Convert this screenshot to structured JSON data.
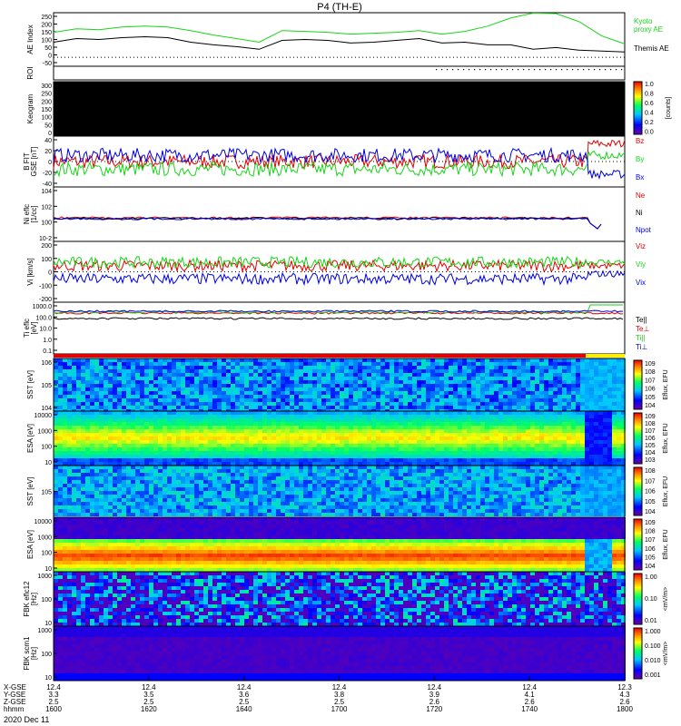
{
  "title": "P4 (TH-E)",
  "date_label": "2020 Dec 11",
  "ephemeris": {
    "row_labels": [
      "X-GSE",
      "Y-GSE",
      "Z-GSE",
      "hhmm"
    ],
    "columns": [
      {
        "x": "12.4",
        "y": "3.3",
        "z": "2.5",
        "t": "1600"
      },
      {
        "x": "12.4",
        "y": "3.5",
        "z": "2.5",
        "t": "1620"
      },
      {
        "x": "12.4",
        "y": "3.6",
        "z": "2.5",
        "t": "1640"
      },
      {
        "x": "12.4",
        "y": "3.8",
        "z": "2.5",
        "t": "1700"
      },
      {
        "x": "12.4",
        "y": "3.9",
        "z": "2.6",
        "t": "1720"
      },
      {
        "x": "12.4",
        "y": "4.1",
        "z": "2.6",
        "t": "1740"
      },
      {
        "x": "12.3",
        "y": "4.3",
        "z": "2.6",
        "t": "1800"
      }
    ]
  },
  "colors": {
    "red": "#e00000",
    "green": "#16d616",
    "blue": "#0000dd",
    "black": "#000000"
  },
  "chart_data": [
    {
      "type": "line",
      "panel": "ae",
      "ylabel": "AE Index",
      "ylim": [
        -50,
        250
      ],
      "yticks": [
        "250",
        "200",
        "150",
        "100",
        "50",
        "0",
        "-50"
      ],
      "x": [
        1550,
        1560,
        1570,
        1580,
        1590,
        1600,
        1610,
        1620,
        1630,
        1640,
        1650,
        1660,
        1670,
        1680,
        1690,
        1700,
        1710,
        1720,
        1730,
        1740,
        1750,
        1760,
        1770,
        1780,
        1790,
        1800
      ],
      "series": [
        {
          "name": "Kyoto proxy AE",
          "color": "green",
          "values": [
            140,
            160,
            155,
            170,
            175,
            170,
            150,
            125,
            105,
            85,
            150,
            145,
            140,
            130,
            135,
            140,
            150,
            130,
            145,
            175,
            220,
            248,
            245,
            200,
            120,
            75
          ]
        },
        {
          "name": "Themis AE",
          "color": "black",
          "values": [
            85,
            105,
            100,
            110,
            115,
            110,
            85,
            70,
            60,
            45,
            95,
            100,
            95,
            80,
            85,
            95,
            105,
            80,
            85,
            70,
            70,
            45,
            55,
            40,
            35,
            30
          ]
        }
      ]
    },
    {
      "type": "table",
      "panel": "roi",
      "ylabel": "ROI"
    },
    {
      "type": "heatmap",
      "panel": "keogram",
      "ylabel": "Keogram",
      "yticks": [
        "300",
        "250",
        "200",
        "150",
        "100",
        "50",
        "0"
      ],
      "colorbar": {
        "ticks": [
          "1.0",
          "0.8",
          "0.6",
          "0.4",
          "0.2",
          "0.0"
        ],
        "label": "[counts]"
      }
    },
    {
      "type": "line",
      "panel": "bfield",
      "ylabel": "B FIT GSE [nT]",
      "ylim": [
        -40,
        40
      ],
      "yticks": [
        "40",
        "20",
        "0",
        "-20",
        "-40"
      ],
      "series": [
        {
          "name": "Bz",
          "color": "red",
          "level": 0
        },
        {
          "name": "By",
          "color": "green",
          "level": -12
        },
        {
          "name": "Bx",
          "color": "blue",
          "level": 10
        }
      ]
    },
    {
      "type": "line",
      "panel": "density",
      "ylabel": "Ni eflc [1/cc]",
      "yticks": [
        "10^4",
        "10^2",
        "10^0",
        "10^-2"
      ],
      "series": [
        {
          "name": "Ne",
          "color": "red"
        },
        {
          "name": "Ni",
          "color": "black"
        },
        {
          "name": "Npot",
          "color": "blue"
        }
      ]
    },
    {
      "type": "line",
      "panel": "velocity",
      "ylabel": "Vi [km/s]",
      "ylim": [
        -300,
        300
      ],
      "yticks": [
        "200",
        "100",
        "0",
        "-100",
        "-200"
      ],
      "series": [
        {
          "name": "Viz",
          "color": "red",
          "level": 60
        },
        {
          "name": "Viy",
          "color": "green",
          "level": 95
        },
        {
          "name": "Vix",
          "color": "blue",
          "level": -70
        }
      ]
    },
    {
      "type": "line",
      "panel": "temperature",
      "ylabel": "Ti eflc [eV]",
      "yticks": [
        "1000.0",
        "100.0",
        "10.0",
        "1.0",
        "0.1"
      ],
      "series": [
        {
          "name": "Te||",
          "color": "black"
        },
        {
          "name": "Te⊥",
          "color": "red"
        },
        {
          "name": "Ti||",
          "color": "green"
        },
        {
          "name": "Ti⊥",
          "color": "blue"
        }
      ]
    },
    {
      "type": "heatmap",
      "panel": "sst-e",
      "ylabel": "SST [eV]",
      "yticks": [
        "10^6",
        "10^5",
        "10^4"
      ],
      "colorbar": {
        "ticks": [
          "10^9",
          "10^8",
          "10^7",
          "10^6",
          "10^5",
          "10^4"
        ],
        "label": "Eflux, EFU"
      }
    },
    {
      "type": "heatmap",
      "panel": "esa-e",
      "ylabel": "ESA [eV]",
      "yticks": [
        "10000",
        "1000",
        "100",
        "10"
      ],
      "colorbar": {
        "ticks": [
          "10^9",
          "10^8",
          "10^7",
          "10^6",
          "10^5",
          "10^4",
          "10^3"
        ],
        "label": "Eflux, EFU"
      }
    },
    {
      "type": "heatmap",
      "panel": "sst-i",
      "ylabel": "SST [eV]",
      "yticks": [
        "10^5"
      ],
      "colorbar": {
        "ticks": [
          "10^8",
          "10^7",
          "10^6",
          "10^5",
          "10^4"
        ],
        "label": "Eflux, EFU"
      }
    },
    {
      "type": "heatmap",
      "panel": "esa-i",
      "ylabel": "ESA [eV]",
      "yticks": [
        "10000",
        "1000",
        "100",
        "10"
      ],
      "colorbar": {
        "ticks": [
          "10^9",
          "10^8",
          "10^7",
          "10^6",
          "10^5",
          "10^4"
        ],
        "label": "Eflux, EFU"
      }
    },
    {
      "type": "heatmap",
      "panel": "fbk-e",
      "ylabel": "FBK eflc12 [Hz]",
      "yticks": [
        "1000",
        "100",
        "10"
      ],
      "colorbar": {
        "ticks": [
          "1.00",
          "0.10",
          "0.01"
        ],
        "label": "<mV/m>"
      }
    },
    {
      "type": "heatmap",
      "panel": "fbk-b",
      "ylabel": "FBK scm1 [Hz]",
      "yticks": [
        "1000",
        "100",
        "10"
      ],
      "colorbar": {
        "ticks": [
          "1.000",
          "0.100",
          "0.010",
          "0.001"
        ],
        "label": "<mV/m>"
      }
    }
  ]
}
